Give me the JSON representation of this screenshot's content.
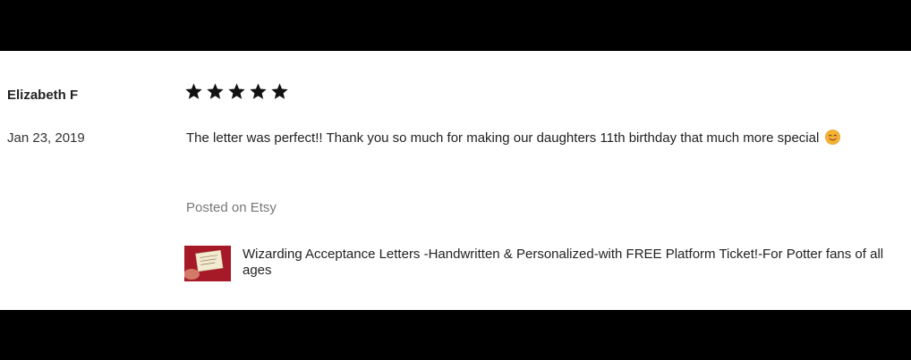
{
  "review": {
    "reviewer_name": "Elizabeth F",
    "date": "Jan 23, 2019",
    "rating": 5,
    "rating_max": 5,
    "text": "The letter was perfect!! Thank you so much for making our daughters 11th birthday that much more special",
    "emoji_icon": "smiling-face-emoji",
    "posted_on": "Posted on Etsy",
    "product": {
      "thumbnail_icon": "product-thumbnail",
      "title": "Wizarding Acceptance Letters -Handwritten & Personalized-with FREE Platform Ticket!-For Potter fans of all ages"
    }
  },
  "colors": {
    "background_bars": "#000000",
    "card": "#ffffff",
    "star": "#111111",
    "muted_text": "#777777",
    "emoji": "#f5b335"
  }
}
